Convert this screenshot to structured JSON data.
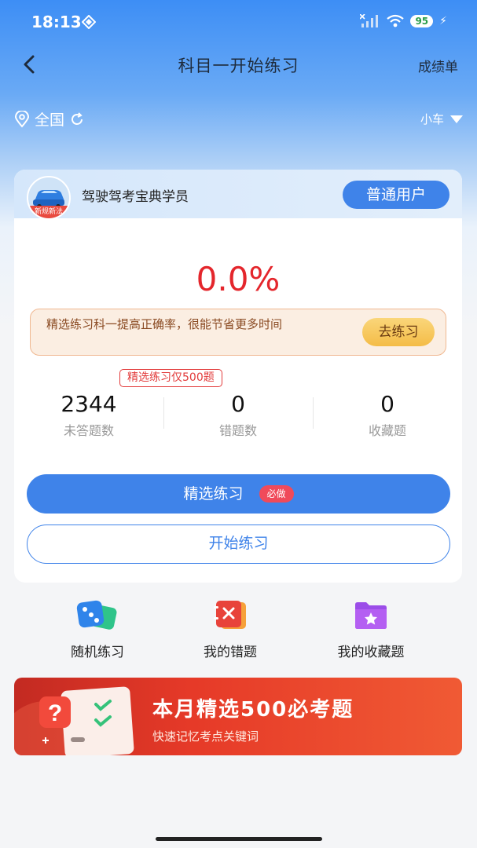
{
  "status_bar": {
    "time": "18:13",
    "battery": "95"
  },
  "nav": {
    "title": "科目一开始练习",
    "right_link": "成绩单"
  },
  "location": {
    "region": "全国",
    "vehicle": "小车"
  },
  "user_card": {
    "avatar_caption": "新规新法",
    "name": "驾驶驾考宝典学员",
    "type_label": "普通用户",
    "accuracy": "0.0%",
    "tip": {
      "text": "精选练习科一提高正确率，很能节省更多时间",
      "button": "去练习"
    },
    "badge": "精选练习仅500题",
    "stats": [
      {
        "value": "2344",
        "label": "未答题数"
      },
      {
        "value": "0",
        "label": "错题数"
      },
      {
        "value": "0",
        "label": "收藏题"
      }
    ],
    "primary_button": "精选练习",
    "primary_badge": "必做",
    "secondary_button": "开始练习"
  },
  "quick_actions": [
    {
      "label": "随机练习",
      "icon": "dice-icon"
    },
    {
      "label": "我的错题",
      "icon": "wrong-book-icon"
    },
    {
      "label": "我的收藏题",
      "icon": "star-folder-icon"
    }
  ],
  "banner": {
    "title": "本月精选500必考题",
    "subtitle": "快速记忆考点关键词"
  },
  "colors": {
    "primary": "#3f83e9",
    "accent_red": "#e4262c",
    "banner_red": "#e63a28"
  }
}
